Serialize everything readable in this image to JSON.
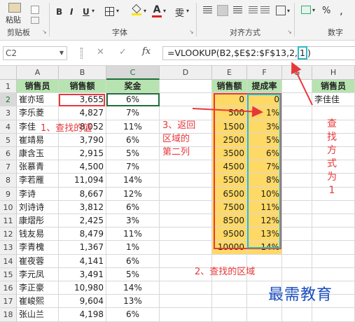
{
  "ribbon": {
    "paste_label": "粘贴",
    "groups": {
      "clipboard": "剪贴板",
      "font": "字体",
      "alignment": "对齐方式",
      "number": "数字"
    },
    "bold": "B",
    "italic": "I",
    "underline": "U",
    "font_color": "A",
    "wen": "雯",
    "percent": "%",
    "comma": ","
  },
  "formula_bar": {
    "name_box": "C2",
    "cancel": "✕",
    "enter": "✓",
    "fx": "fx",
    "formula_before": "=VLOOKUP(B2,$E$2:$F$13,2,",
    "formula_highlight": "1",
    "formula_after": ")"
  },
  "columns": [
    "A",
    "B",
    "C",
    "D",
    "E",
    "F",
    "G",
    "H"
  ],
  "rows": [
    "1",
    "2",
    "3",
    "4",
    "5",
    "6",
    "7",
    "8",
    "9",
    "10",
    "11",
    "12",
    "13",
    "14",
    "15",
    "16",
    "17",
    "18"
  ],
  "table_left": {
    "headers": [
      "销售员",
      "销售额",
      "奖金"
    ],
    "rows": [
      [
        "崔亦瑶",
        "3,655",
        "6%"
      ],
      [
        "李乐菱",
        "4,827",
        "7%"
      ],
      [
        "李佳",
        "8,052",
        "11%"
      ],
      [
        "崔靖易",
        "3,790",
        "6%"
      ],
      [
        "康含玉",
        "2,915",
        "5%"
      ],
      [
        "张慕青",
        "4,500",
        "7%"
      ],
      [
        "李若雁",
        "11,094",
        "14%"
      ],
      [
        "李诗",
        "8,667",
        "12%"
      ],
      [
        "刘诗诗",
        "3,812",
        "6%"
      ],
      [
        "康熠彤",
        "2,425",
        "3%"
      ],
      [
        "钱友易",
        "8,479",
        "11%"
      ],
      [
        "李青槐",
        "1,367",
        "1%"
      ],
      [
        "崔夜蓉",
        "4,141",
        "6%"
      ],
      [
        "李元凤",
        "3,491",
        "5%"
      ],
      [
        "李正豪",
        "10,980",
        "14%"
      ],
      [
        "崔峻熙",
        "9,604",
        "13%"
      ],
      [
        "张山兰",
        "4,198",
        "6%"
      ]
    ]
  },
  "table_right": {
    "headers": [
      "销售额",
      "提成率"
    ],
    "rows": [
      [
        "0",
        "0"
      ],
      [
        "500",
        "1%"
      ],
      [
        "1500",
        "3%"
      ],
      [
        "2500",
        "5%"
      ],
      [
        "3500",
        "6%"
      ],
      [
        "4500",
        "7%"
      ],
      [
        "5500",
        "8%"
      ],
      [
        "6500",
        "10%"
      ],
      [
        "7500",
        "11%"
      ],
      [
        "8500",
        "12%"
      ],
      [
        "9500",
        "13%"
      ],
      [
        "10000",
        "14%"
      ]
    ]
  },
  "table_h": {
    "header": "销售员",
    "value": "李佳佳"
  },
  "annotations": {
    "a1": "1、查找的值",
    "a2": "2、查找的区域",
    "a3_lines": [
      "3、返回",
      "区域的",
      "第二列"
    ],
    "a4_chars": [
      "查",
      "找",
      "方",
      "式",
      "为",
      "1"
    ]
  },
  "watermark": "最需教育",
  "colors": {
    "header_green": "#b7e3b0",
    "annotation_red": "#e8373a",
    "highlight_teal": "#2fb8c8",
    "select_green": "#1e6e3a"
  }
}
